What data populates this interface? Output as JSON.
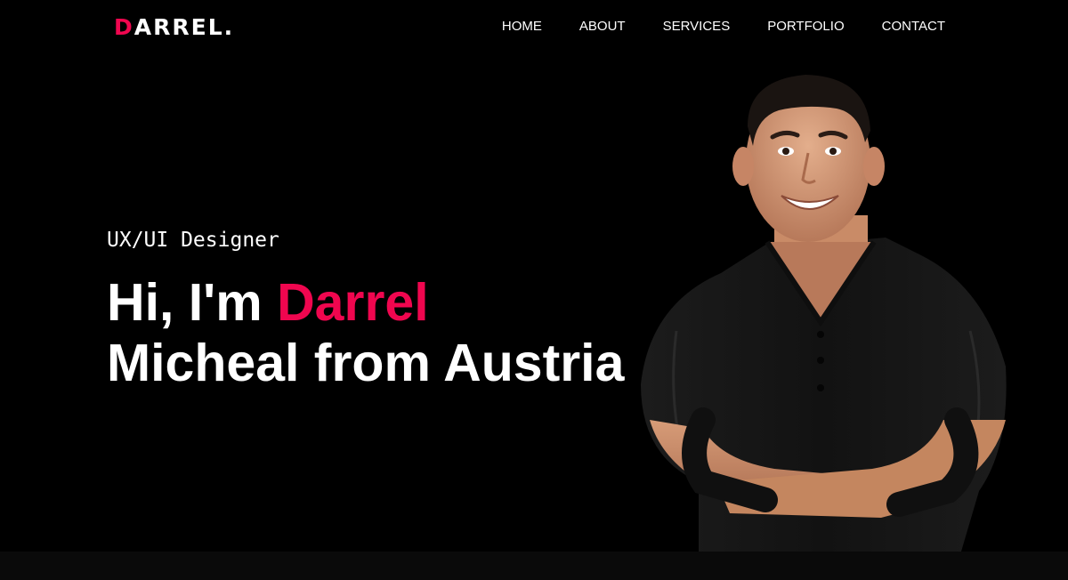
{
  "brand": {
    "logo_first_letter": "D",
    "logo_rest": "ARREL.",
    "accent_color": "#f0064f"
  },
  "nav": {
    "items": [
      {
        "label": "HOME"
      },
      {
        "label": "ABOUT"
      },
      {
        "label": "SERVICES"
      },
      {
        "label": "PORTFOLIO"
      },
      {
        "label": "CONTACT"
      }
    ]
  },
  "hero": {
    "subtitle": "UX/UI Designer",
    "greeting": "Hi, I'm ",
    "name_highlight": "Darrel",
    "line2": "Micheal from Austria",
    "portrait_icon": "man-portrait-crossed-arms"
  }
}
